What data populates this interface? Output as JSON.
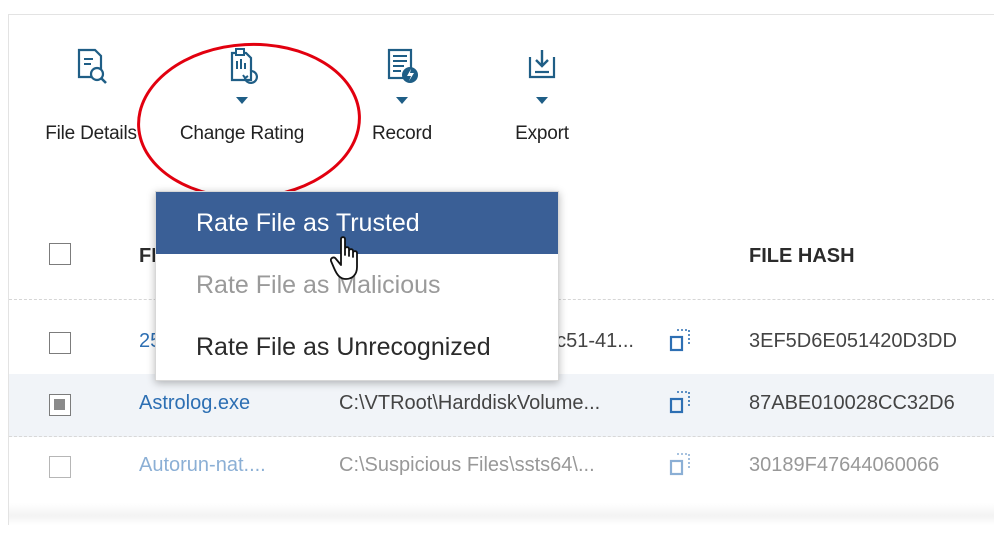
{
  "toolbar": {
    "file_details": "File Details",
    "change_rating": "Change Rating",
    "record": "Record",
    "export": "Export"
  },
  "table": {
    "header_file": "FI",
    "header_hash": "FILE HASH"
  },
  "rows": [
    {
      "name": "25",
      "path": "6c51-41...",
      "hash": "3EF5D6E051420D3DD",
      "checked": false
    },
    {
      "name": "Astrolog.exe",
      "path": "C:\\VTRoot\\HarddiskVolume...",
      "hash": "87ABE010028CC32D6",
      "checked": true
    },
    {
      "name": "Autorun-nat....",
      "path": "C:\\Suspicious Files\\ssts64\\...",
      "hash": "30189F47644060066",
      "checked": false
    }
  ],
  "menu": {
    "trusted": "Rate File as Trusted",
    "malicious": "Rate File as Malicious",
    "unrecognized": "Rate File as Unrecognized"
  },
  "colors": {
    "accent": "#3a5f96",
    "link": "#2d6fb3",
    "highlight_ring": "#e2000f",
    "icon": "#1f5e86"
  }
}
